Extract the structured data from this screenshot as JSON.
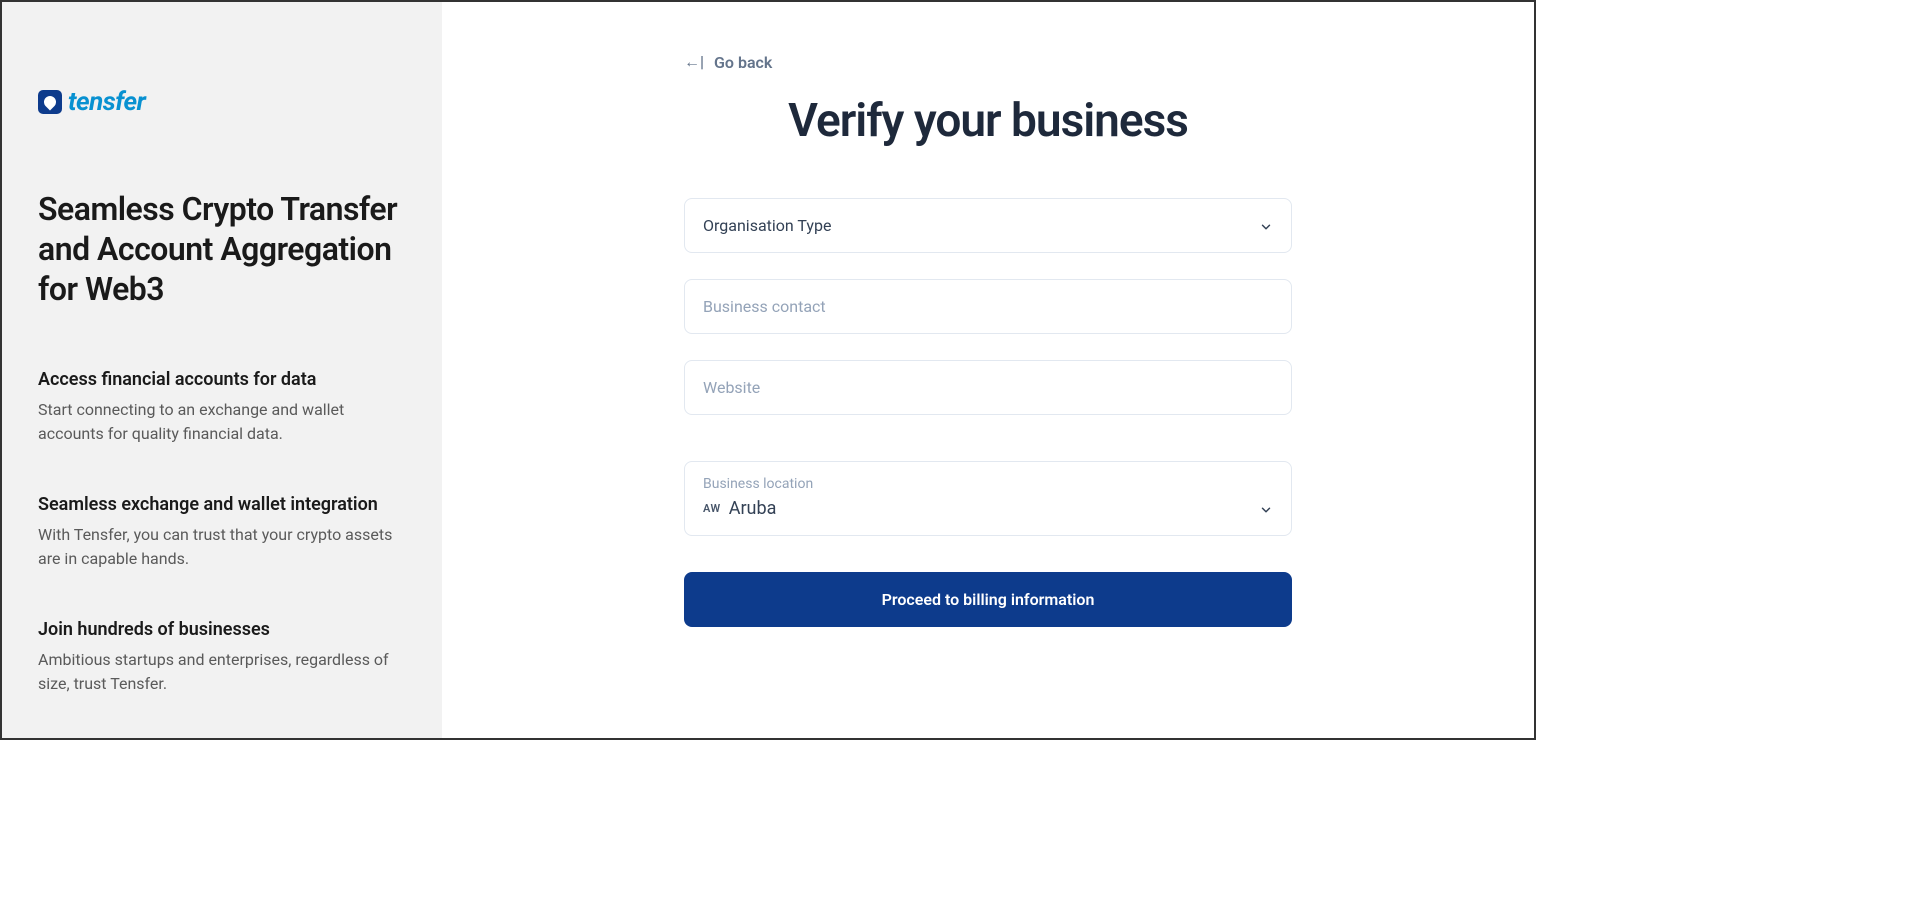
{
  "sidebar": {
    "logo_text": "tensfer",
    "headline": "Seamless Crypto Transfer and Account Aggregation for Web3",
    "features": [
      {
        "title": "Access financial accounts for data",
        "desc": "Start connecting to an exchange and wallet accounts for quality financial data."
      },
      {
        "title": "Seamless exchange and wallet integration",
        "desc": "With Tensfer, you can trust that your crypto assets are in capable hands."
      },
      {
        "title": "Join hundreds of businesses",
        "desc": "Ambitious startups and enterprises, regardless of size, trust Tensfer."
      }
    ]
  },
  "main": {
    "back_label": "Go back",
    "page_title": "Verify your business",
    "org_type_label": "Organisation Type",
    "business_contact_placeholder": "Business contact",
    "website_placeholder": "Website",
    "location_label": "Business location",
    "location_country_code": "AW",
    "location_country_name": "Aruba",
    "submit_label": "Proceed to billing information"
  }
}
